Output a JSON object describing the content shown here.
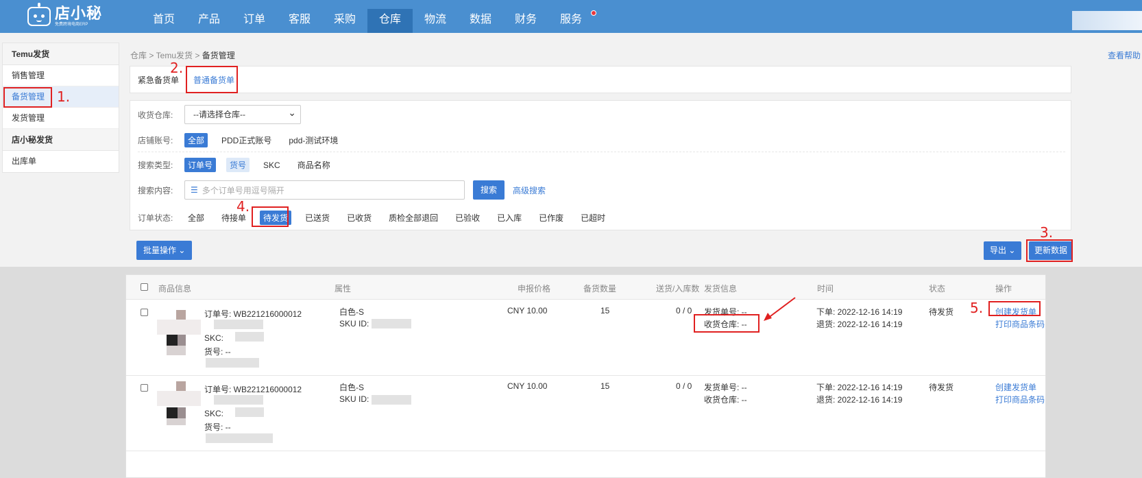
{
  "header": {
    "logo_name": "店小秘",
    "logo_sub": "免费跨境电商ERP",
    "nav": [
      "首页",
      "产品",
      "订单",
      "客服",
      "采购",
      "仓库",
      "物流",
      "数据",
      "财务",
      "服务"
    ]
  },
  "sidebar": {
    "group1": "Temu发货",
    "items1": [
      "销售管理",
      "备货管理",
      "发货管理"
    ],
    "group2": "店小秘发货",
    "items2": [
      "出库单"
    ]
  },
  "breadcrumb": {
    "path": "仓库 > Temu发货 > ",
    "current": "备货管理"
  },
  "help": "查看帮助",
  "tabs": [
    "紧急备货单",
    "普通备货单"
  ],
  "filters": {
    "warehouse_label": "收货仓库:",
    "warehouse_value": "--请选择仓库--",
    "store_label": "店铺账号:",
    "store_options": [
      "全部",
      "PDD正式账号",
      "pdd-测试环境"
    ],
    "search_type_label": "搜索类型:",
    "search_type_options": [
      "订单号",
      "货号",
      "SKC",
      "商品名称"
    ],
    "search_content_label": "搜索内容:",
    "search_placeholder": "多个订单号用逗号隔开",
    "search_button": "搜索",
    "advanced_search": "高级搜索",
    "status_label": "订单状态:",
    "status_options": [
      "全部",
      "待接单",
      "待发货",
      "已送货",
      "已收货",
      "质检全部退回",
      "已验收",
      "已入库",
      "已作废",
      "已超时"
    ]
  },
  "actions": {
    "bulk": "批量操作",
    "export": "导出",
    "refresh": "更新数据"
  },
  "table": {
    "headers": [
      "商品信息",
      "属性",
      "申报价格",
      "备货数量",
      "送货/入库数",
      "发货信息",
      "时间",
      "状态",
      "操作"
    ],
    "rows": [
      {
        "order_no": "订单号: WB221216000012",
        "skc": "SKC:",
        "sku_code": "货号: --",
        "attr": "白色-S",
        "sku_id": "SKU ID:",
        "price": "CNY 10.00",
        "qty": "15",
        "delivered": "0 / 0",
        "ship_no": "发货单号: --",
        "warehouse": "收货仓库: --",
        "order_time": "下单: 2022-12-16 14:19",
        "return_time": "退货: 2022-12-16 14:19",
        "status": "待发货",
        "op1": "创建发货单",
        "op2": "打印商品条码"
      },
      {
        "order_no": "订单号: WB221216000012",
        "skc": "SKC:",
        "sku_code": "货号: --",
        "attr": "白色-S",
        "sku_id": "SKU ID:",
        "price": "CNY 10.00",
        "qty": "15",
        "delivered": "0 / 0",
        "ship_no": "发货单号: --",
        "warehouse": "收货仓库: --",
        "order_time": "下单: 2022-12-16 14:19",
        "return_time": "退货: 2022-12-16 14:19",
        "status": "待发货",
        "op1": "创建发货单",
        "op2": "打印商品条码"
      }
    ]
  },
  "annotations": [
    "1.",
    "2.",
    "3.",
    "4.",
    "5."
  ]
}
